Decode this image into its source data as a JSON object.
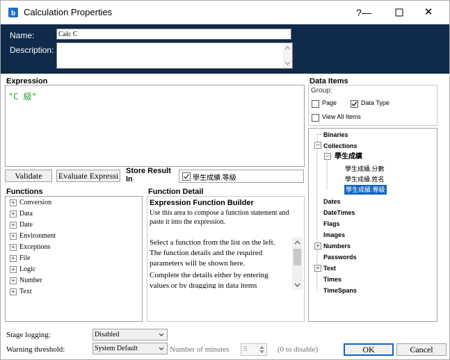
{
  "window": {
    "title": "Calculation Properties",
    "help": "?",
    "minimize": "—",
    "close": "✕"
  },
  "header": {
    "name_label": "Name:",
    "name_value": "Calc C",
    "description_label": "Description:",
    "description_value": ""
  },
  "expression": {
    "label": "Expression",
    "value": "\"C 級\""
  },
  "buttons": {
    "validate": "Validate",
    "evaluate": "Evaluate Expressi",
    "ok": "OK",
    "cancel": "Cancel"
  },
  "store_result": {
    "label": "Store Result In",
    "value": "學生成績.等級"
  },
  "functions": {
    "label": "Functions",
    "items": [
      "Conversion",
      "Data",
      "Date",
      "Environment",
      "Exceptions",
      "File",
      "Logic",
      "Number",
      "Text"
    ]
  },
  "function_detail": {
    "label": "Function Detail",
    "title": "Expression Function Builder",
    "intro": "Use this area to compose a function statement and paste it into the expression.",
    "para1": "Select a function from the list on the left. The function details and the required parameters will be shown here.",
    "para2": "Complete the details either by entering values or by dragging in data items"
  },
  "data_items": {
    "label": "Data Items",
    "group_label": "Group:",
    "page_label": "Page",
    "page_checked": false,
    "datatype_label": "Data Type",
    "datatype_checked": true,
    "viewall_label": "View All Items",
    "viewall_checked": false,
    "tree": {
      "binaries": "Binaries",
      "collections": "Collections",
      "collection_name": "學生成績",
      "field1": "學生成績.分數",
      "field2": "學生成績.姓名",
      "field3": "學生成績.等級",
      "dates": "Dates",
      "datetimes": "DateTimes",
      "flags": "Flags",
      "images": "Images",
      "numbers": "Numbers",
      "passwords": "Passwords",
      "text": "Text",
      "times": "Times",
      "timespans": "TimeSpans"
    }
  },
  "footer": {
    "stage_logging_label": "Stage logging:",
    "stage_logging_value": "Disabled",
    "warning_label": "Warning threshold:",
    "warning_value": "System Default",
    "minutes_label": "Number of minutes",
    "minutes_value": "5",
    "disable_hint": "(0 to disable)"
  },
  "colors": {
    "header_bg": "#0f2a4a",
    "expression_text": "#22a022",
    "selection": "#1565c0"
  }
}
